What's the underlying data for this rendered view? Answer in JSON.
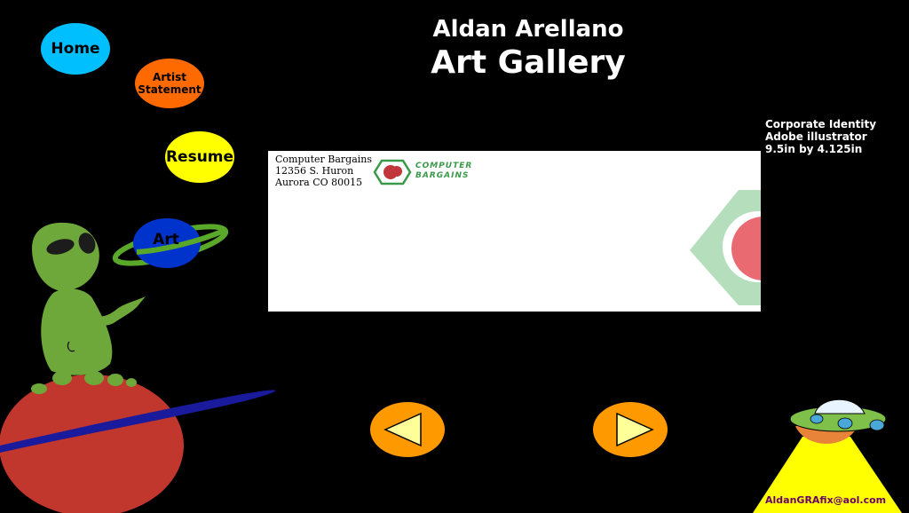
{
  "header": {
    "artist_name": "Aldan Arellano",
    "gallery_title": "Art Gallery"
  },
  "nav": {
    "home": "Home",
    "artist_statement_line1": "Artist",
    "artist_statement_line2": "Statement",
    "resume": "Resume",
    "art": "Art"
  },
  "artwork": {
    "address_line1": "Computer Bargains",
    "address_line2": "12356 S. Huron",
    "address_line3": "Aurora CO 80015",
    "logo_line1": "COMPUTER",
    "logo_line2": "BARGAINS"
  },
  "details": {
    "category": "Corporate Identity",
    "software": "Adobe illustrator",
    "size": "9.5in by 4.125in"
  },
  "footer": {
    "email": "AldanGRAfix@aol.com"
  },
  "icons": {
    "prev": "left-arrow-icon",
    "next": "right-arrow-icon",
    "alien": "alien-illustration",
    "planet": "planet-illustration",
    "ufo": "ufo-illustration"
  },
  "colors": {
    "home": "#00bfff",
    "artist_statement": "#ff6a00",
    "resume": "#ffff00",
    "art": "#0033cc",
    "arrow_button": "#ff9900",
    "arrow_glyph": "#ffff99"
  }
}
